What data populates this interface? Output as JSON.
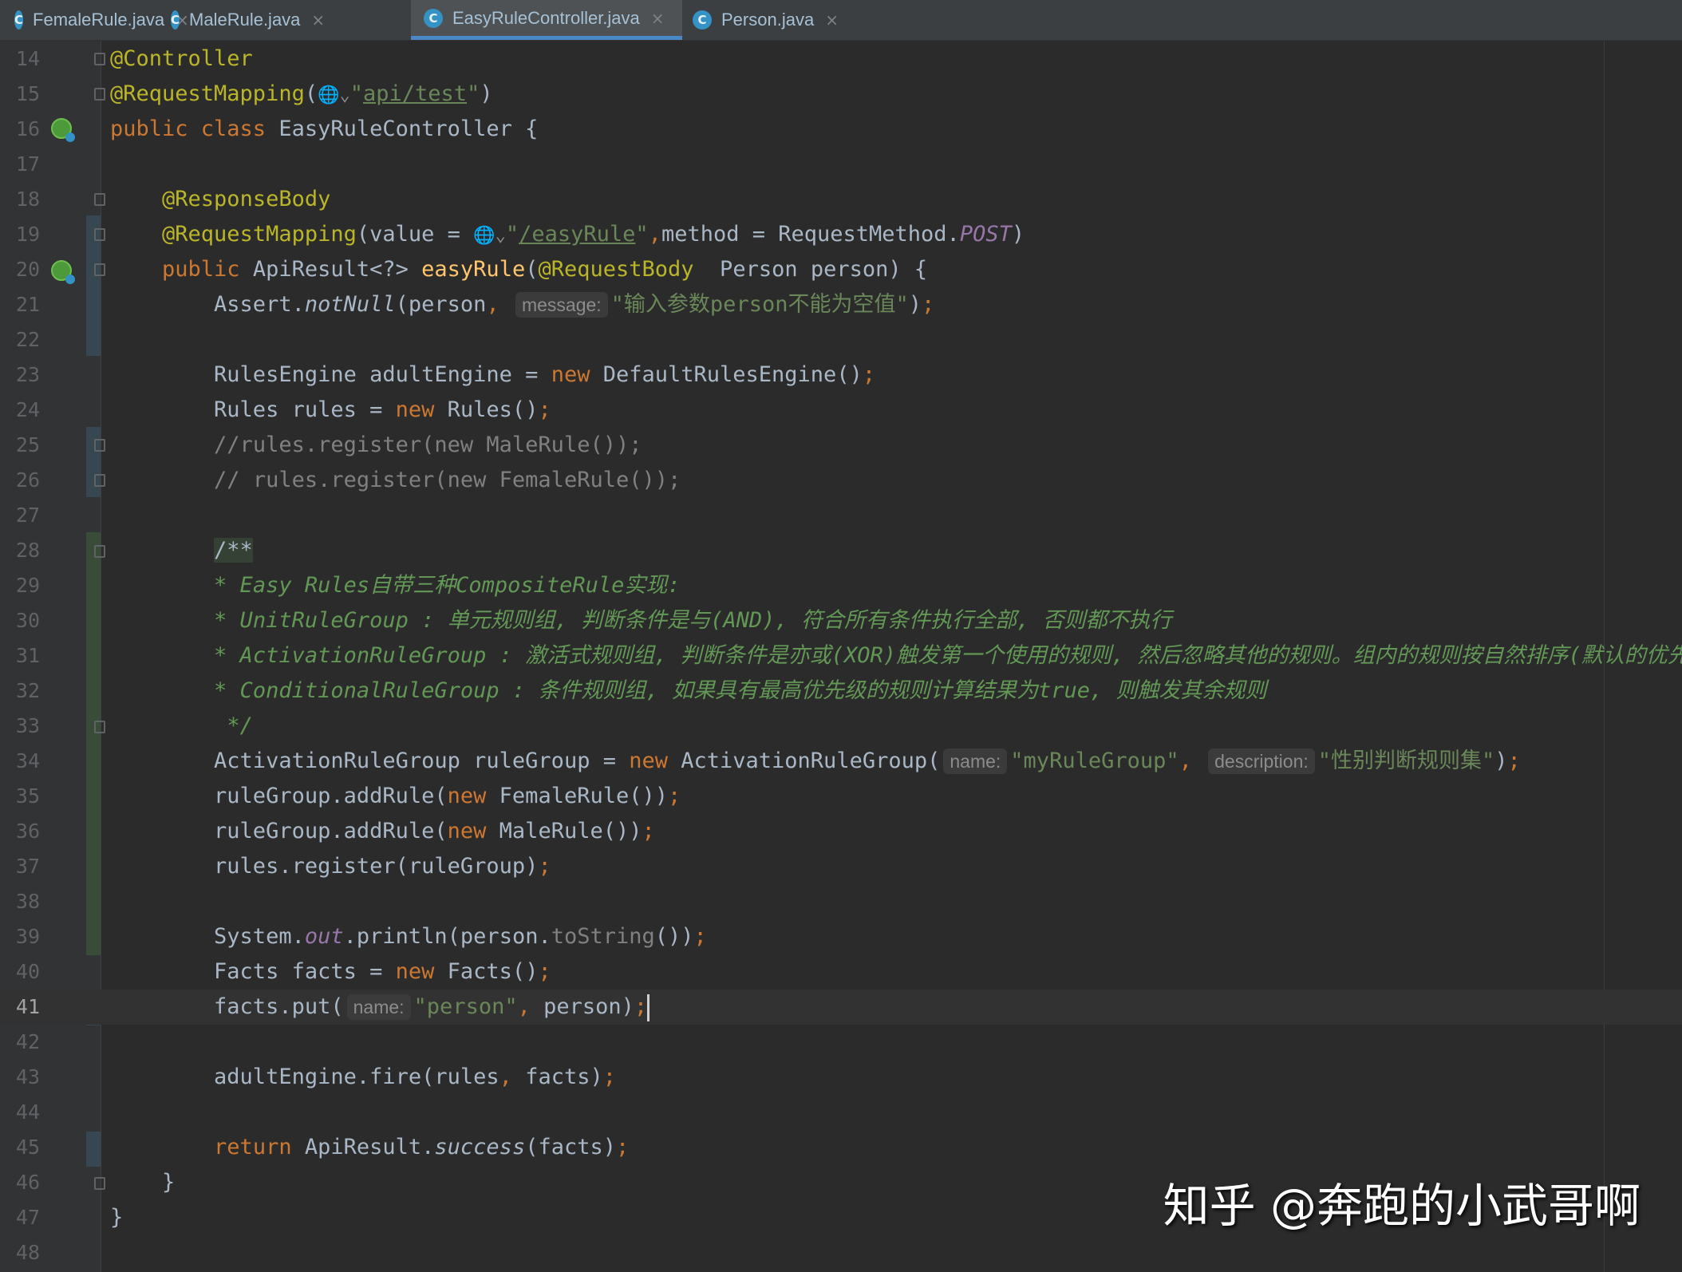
{
  "tabs": [
    {
      "label": "FemaleRule.java",
      "icon": "C",
      "active": false
    },
    {
      "label": "MaleRule.java",
      "icon": "C",
      "active": false
    },
    {
      "label": "EasyRuleController.java",
      "icon": "C",
      "active": true
    },
    {
      "label": "Person.java",
      "icon": "C",
      "active": false
    }
  ],
  "tab_close_glyph": "×",
  "editor": {
    "current_line": "41",
    "lines": [
      {
        "num": "14",
        "segments": [
          [
            "ann",
            "@Controller"
          ]
        ]
      },
      {
        "num": "15",
        "segments": [
          [
            "ann",
            "@RequestMapping"
          ],
          [
            "",
            "("
          ],
          [
            "globe",
            "🌐⌄"
          ],
          [
            "str",
            "\""
          ],
          [
            "link",
            "api/test"
          ],
          [
            "str",
            "\""
          ],
          [
            "",
            ")"
          ]
        ]
      },
      {
        "num": "16",
        "segments": [
          [
            "kw",
            "public class "
          ],
          [
            "",
            "EasyRuleController {"
          ]
        ]
      },
      {
        "num": "17",
        "segments": []
      },
      {
        "num": "18",
        "segments": [
          [
            "",
            "    "
          ],
          [
            "ann",
            "@ResponseBody"
          ]
        ]
      },
      {
        "num": "19",
        "segments": [
          [
            "",
            "    "
          ],
          [
            "ann",
            "@RequestMapping"
          ],
          [
            "",
            "(value = "
          ],
          [
            "globe",
            "🌐⌄"
          ],
          [
            "str",
            "\""
          ],
          [
            "link",
            "/easyRule"
          ],
          [
            "str",
            "\""
          ],
          [
            "kw",
            ","
          ],
          [
            "",
            "method = RequestMethod."
          ],
          [
            "static",
            "POST"
          ],
          [
            "",
            ")"
          ]
        ]
      },
      {
        "num": "20",
        "segments": [
          [
            "",
            "    "
          ],
          [
            "kw",
            "public "
          ],
          [
            "",
            "ApiResult<?> "
          ],
          [
            "fn",
            "easyRule"
          ],
          [
            "",
            "("
          ],
          [
            "ann",
            "@RequestBody"
          ],
          [
            "",
            "  Person person) {"
          ]
        ]
      },
      {
        "num": "21",
        "segments": [
          [
            "",
            "        Assert."
          ],
          [
            "ital",
            "notNull"
          ],
          [
            "",
            "(person"
          ],
          [
            "kw",
            ", "
          ],
          [
            "hint",
            "message:"
          ],
          [
            "str",
            "\"输入参数person不能为空值\""
          ],
          [
            "",
            ")"
          ],
          [
            "kw",
            ";"
          ]
        ]
      },
      {
        "num": "22",
        "segments": []
      },
      {
        "num": "23",
        "segments": [
          [
            "",
            "        RulesEngine adultEngine = "
          ],
          [
            "kw",
            "new "
          ],
          [
            "",
            "DefaultRulesEngine()"
          ],
          [
            "kw",
            ";"
          ]
        ]
      },
      {
        "num": "24",
        "segments": [
          [
            "",
            "        Rules rules = "
          ],
          [
            "kw",
            "new "
          ],
          [
            "",
            "Rules()"
          ],
          [
            "kw",
            ";"
          ]
        ]
      },
      {
        "num": "25",
        "segments": [
          [
            "",
            "        "
          ],
          [
            "cmt",
            "//rules.register(new MaleRule());"
          ]
        ]
      },
      {
        "num": "26",
        "segments": [
          [
            "",
            "        "
          ],
          [
            "cmt",
            "// rules.register(new FemaleRule());"
          ]
        ]
      },
      {
        "num": "27",
        "segments": []
      },
      {
        "num": "28",
        "segments": [
          [
            "",
            "        "
          ],
          [
            "doc-start",
            "/**"
          ]
        ]
      },
      {
        "num": "29",
        "segments": [
          [
            "",
            "        "
          ],
          [
            "doc",
            "* Easy Rules自带三种CompositeRule实现:"
          ]
        ]
      },
      {
        "num": "30",
        "segments": [
          [
            "",
            "        "
          ],
          [
            "doc",
            "* UnitRuleGroup : 单元规则组, 判断条件是与(AND), 符合所有条件执行全部, 否则都不执行"
          ]
        ]
      },
      {
        "num": "31",
        "segments": [
          [
            "",
            "        "
          ],
          [
            "doc",
            "* ActivationRuleGroup : 激活式规则组, 判断条件是亦或(XOR)触发第一个使用的规则, 然后忽略其他的规则。组内的规则按自然排序(默认的优先级)"
          ]
        ]
      },
      {
        "num": "32",
        "segments": [
          [
            "",
            "        "
          ],
          [
            "doc",
            "* ConditionalRuleGroup : 条件规则组, 如果具有最高优先级的规则计算结果为true, 则触发其余规则"
          ]
        ]
      },
      {
        "num": "33",
        "segments": [
          [
            "",
            "         "
          ],
          [
            "doc",
            "*/"
          ]
        ]
      },
      {
        "num": "34",
        "segments": [
          [
            "",
            "        ActivationRuleGroup ruleGroup = "
          ],
          [
            "kw",
            "new "
          ],
          [
            "",
            "ActivationRuleGroup("
          ],
          [
            "hint",
            "name:"
          ],
          [
            "str",
            "\"myRuleGroup\""
          ],
          [
            "kw",
            ", "
          ],
          [
            "hint",
            "description:"
          ],
          [
            "str",
            "\"性别判断规则集\""
          ],
          [
            "",
            ")"
          ],
          [
            "kw",
            ";"
          ]
        ]
      },
      {
        "num": "35",
        "segments": [
          [
            "",
            "        ruleGroup.addRule("
          ],
          [
            "kw",
            "new "
          ],
          [
            "",
            "FemaleRule())"
          ],
          [
            "kw",
            ";"
          ]
        ]
      },
      {
        "num": "36",
        "segments": [
          [
            "",
            "        ruleGroup.addRule("
          ],
          [
            "kw",
            "new "
          ],
          [
            "",
            "MaleRule())"
          ],
          [
            "kw",
            ";"
          ]
        ]
      },
      {
        "num": "37",
        "segments": [
          [
            "",
            "        rules.register(ruleGroup)"
          ],
          [
            "kw",
            ";"
          ]
        ]
      },
      {
        "num": "38",
        "segments": []
      },
      {
        "num": "39",
        "segments": [
          [
            "",
            "        System."
          ],
          [
            "static",
            "out"
          ],
          [
            "",
            ".println(person."
          ],
          [
            "deprec",
            "toString"
          ],
          [
            "",
            "())"
          ],
          [
            "kw",
            ";"
          ]
        ]
      },
      {
        "num": "40",
        "segments": [
          [
            "",
            "        Facts facts = "
          ],
          [
            "kw",
            "new "
          ],
          [
            "",
            "Facts()"
          ],
          [
            "kw",
            ";"
          ]
        ]
      },
      {
        "num": "41",
        "segments": [
          [
            "",
            "        facts.put("
          ],
          [
            "hint",
            "name:"
          ],
          [
            "str",
            "\"person\""
          ],
          [
            "kw",
            ", "
          ],
          [
            "",
            "person)"
          ],
          [
            "kw",
            ";"
          ],
          [
            "caret",
            ""
          ]
        ]
      },
      {
        "num": "42",
        "segments": []
      },
      {
        "num": "43",
        "segments": [
          [
            "",
            "        adultEngine.fire(rules"
          ],
          [
            "kw",
            ", "
          ],
          [
            "",
            "facts)"
          ],
          [
            "kw",
            ";"
          ]
        ]
      },
      {
        "num": "44",
        "segments": []
      },
      {
        "num": "45",
        "segments": [
          [
            "",
            "        "
          ],
          [
            "kw",
            "return "
          ],
          [
            "",
            "ApiResult."
          ],
          [
            "ital",
            "success"
          ],
          [
            "",
            "(facts)"
          ],
          [
            "kw",
            ";"
          ]
        ]
      },
      {
        "num": "46",
        "segments": [
          [
            "",
            "    }"
          ]
        ]
      },
      {
        "num": "47",
        "segments": [
          [
            "",
            "}"
          ]
        ]
      },
      {
        "num": "48",
        "segments": []
      }
    ]
  },
  "watermark": "知乎 @奔跑的小武哥啊",
  "colors": {
    "background": "#2b2b2b",
    "keyword": "#cc7832",
    "annotation": "#bbb529",
    "string": "#6a8759",
    "doc_comment": "#629755",
    "method_decl": "#ffc66d",
    "active_tab_underline": "#4a88c7"
  }
}
